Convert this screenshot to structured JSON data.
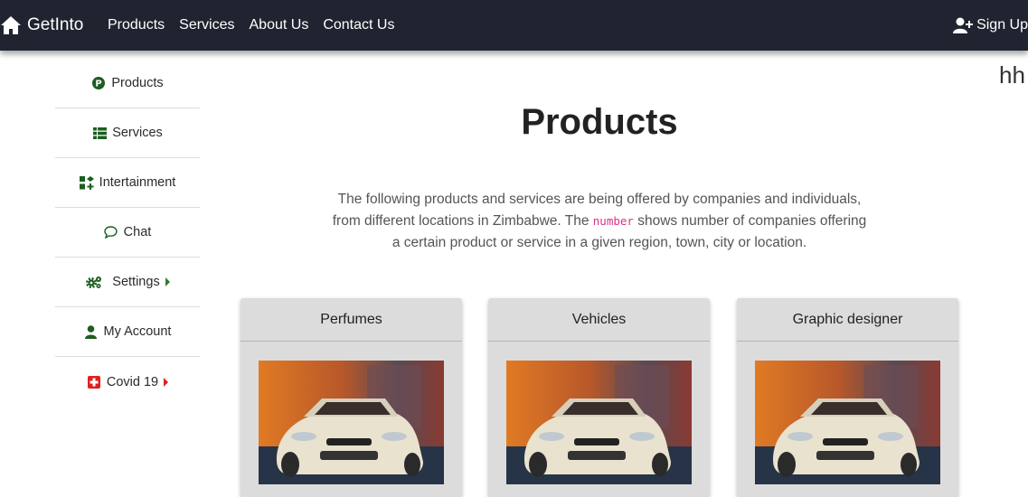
{
  "navbar": {
    "brand": "GetInto",
    "links": [
      "Products",
      "Services",
      "About Us",
      "Contact Us"
    ],
    "signup": "Sign Up"
  },
  "sidebar": {
    "items": [
      {
        "label": "Products",
        "icon": "product-p-icon"
      },
      {
        "label": "Services",
        "icon": "list-icon"
      },
      {
        "label": "Intertainment",
        "icon": "gamepad-icon"
      },
      {
        "label": "Chat",
        "icon": "chat-bubble-icon"
      },
      {
        "label": "Settings",
        "icon": "gears-icon",
        "caret": true
      },
      {
        "label": "My Account",
        "icon": "user-icon"
      },
      {
        "label": "Covid 19",
        "icon": "medical-cross-icon",
        "caret": true
      }
    ]
  },
  "main": {
    "corner_text": "hh",
    "title": "Products",
    "intro_part1": "The following products and services are being offered by companies and individuals, from different locations in Zimbabwe. The ",
    "intro_code": "number",
    "intro_part2": " shows number of companies offering a certain product or service in a given region, town, city or location.",
    "cards": [
      {
        "title": "Perfumes"
      },
      {
        "title": "Vehicles"
      },
      {
        "title": "Graphic designer"
      }
    ]
  },
  "colors": {
    "navbar_bg": "#1f2430",
    "icon_green": "#1b5e20",
    "caret_green": "#2e7d32",
    "covid_red": "#e02020",
    "code_pink": "#d63384",
    "card_bg": "#dcdcdc"
  }
}
